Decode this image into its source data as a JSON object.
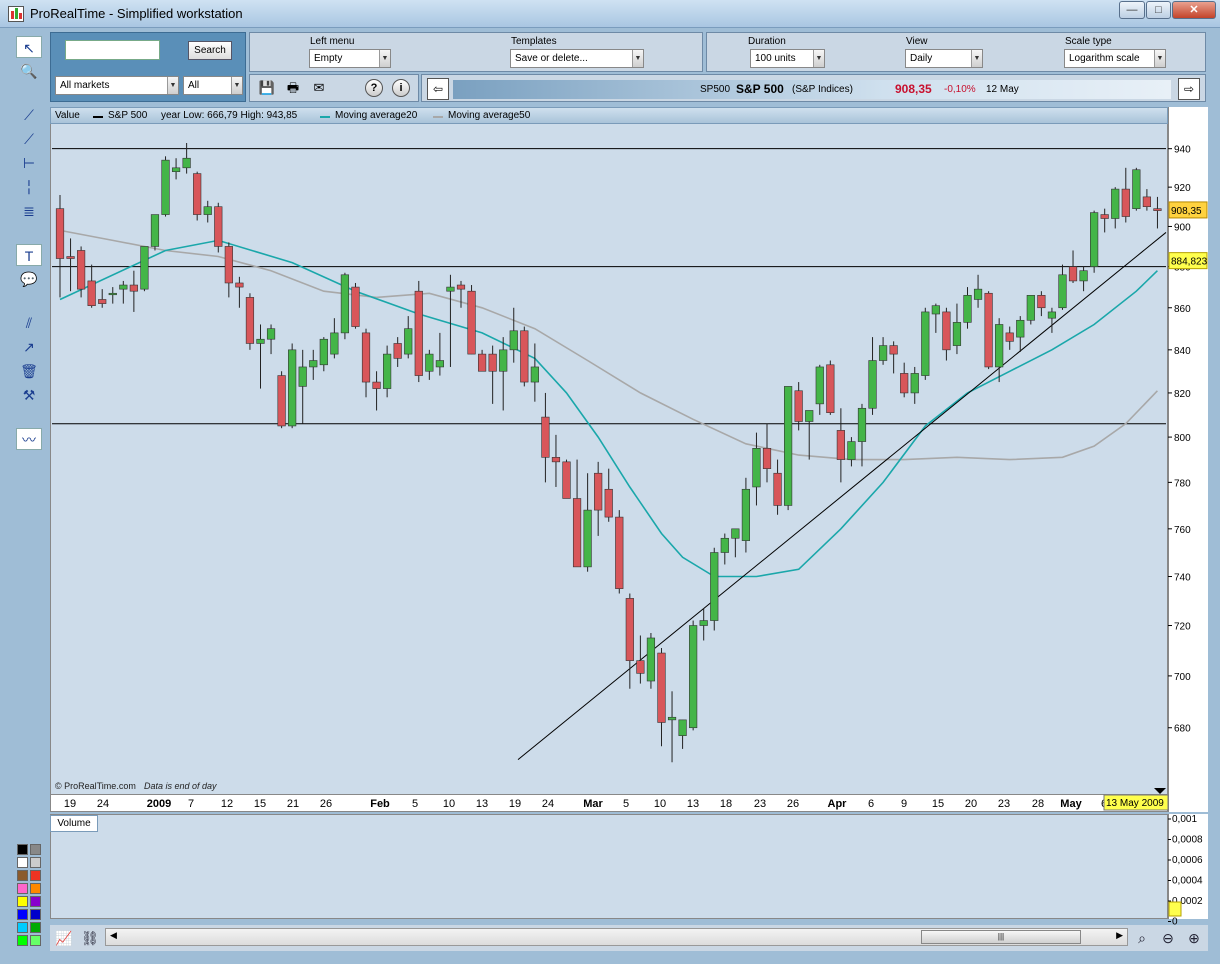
{
  "window": {
    "title": "ProRealTime - Simplified workstation"
  },
  "search": {
    "button_label": "Search",
    "input_value": "",
    "market_select": "All markets",
    "type_select": "All"
  },
  "menu_panel": {
    "left_menu_label": "Left menu",
    "left_menu_value": "Empty",
    "templates_label": "Templates",
    "templates_value": "Save or delete..."
  },
  "settings_panel": {
    "duration_label": "Duration",
    "duration_value": "100 units",
    "view_label": "View",
    "view_value": "Daily",
    "scale_label": "Scale type",
    "scale_value": "Logarithm scale"
  },
  "ticker": {
    "code": "SP500",
    "name": "S&P 500",
    "market": "(S&P Indices)",
    "price": "908,35",
    "change": "-0,10%",
    "date": "12 May"
  },
  "legend": {
    "value_label": "Value",
    "series_label": "S&P 500",
    "range_text": "year Low: 666,79 High: 943,85",
    "ma20_label": "Moving average20",
    "ma50_label": "Moving average50"
  },
  "watermark": {
    "brand": "© ProRealTime.com",
    "note": "Data is end of day"
  },
  "volume": {
    "label": "Volume",
    "ticks": [
      "0,001",
      "0,0008",
      "0,0006",
      "0,0004",
      "0,0002",
      "0"
    ]
  },
  "markers": {
    "last_price": "908,35",
    "level_price": "884,823",
    "cursor_date": "13 May 2009"
  },
  "colors": {
    "up": "#44b548",
    "down": "#d8565a",
    "ma20": "#1aa7aa",
    "ma50": "#a8a8a8",
    "chart_bg": "#cddcea"
  },
  "chart_data": {
    "type": "candlestick",
    "title": "S&P 500",
    "scale": "log",
    "ylim": [
      656,
      952
    ],
    "y_ticks": [
      680,
      700,
      720,
      740,
      760,
      780,
      800,
      820,
      840,
      860,
      880,
      900,
      920,
      940
    ],
    "x_tick_labels": [
      "19",
      "24",
      "2009",
      "7",
      "12",
      "15",
      "21",
      "26",
      "Feb",
      "5",
      "10",
      "13",
      "19",
      "24",
      "Mar",
      "5",
      "10",
      "13",
      "18",
      "23",
      "26",
      "Apr",
      "6",
      "9",
      "15",
      "20",
      "23",
      "28",
      "May",
      "6"
    ],
    "horizontal_lines": [
      940,
      880,
      806
    ],
    "candles": [
      {
        "o": 909,
        "h": 916,
        "l": 865,
        "c": 884
      },
      {
        "o": 885,
        "h": 894,
        "l": 868,
        "c": 884
      },
      {
        "o": 888,
        "h": 890,
        "l": 865,
        "c": 869
      },
      {
        "o": 873,
        "h": 881,
        "l": 860,
        "c": 861
      },
      {
        "o": 864,
        "h": 869,
        "l": 860,
        "c": 862
      },
      {
        "o": 867,
        "h": 870,
        "l": 862,
        "c": 867
      },
      {
        "o": 869,
        "h": 873,
        "l": 862,
        "c": 871
      },
      {
        "o": 871,
        "h": 878,
        "l": 858,
        "c": 868
      },
      {
        "o": 869,
        "h": 890,
        "l": 868,
        "c": 890
      },
      {
        "o": 890,
        "h": 905,
        "l": 888,
        "c": 906
      },
      {
        "o": 906,
        "h": 936,
        "l": 905,
        "c": 934
      },
      {
        "o": 928,
        "h": 935,
        "l": 924,
        "c": 930
      },
      {
        "o": 930,
        "h": 943,
        "l": 927,
        "c": 935
      },
      {
        "o": 927,
        "h": 928,
        "l": 903,
        "c": 906
      },
      {
        "o": 906,
        "h": 913,
        "l": 902,
        "c": 910
      },
      {
        "o": 910,
        "h": 912,
        "l": 887,
        "c": 890
      },
      {
        "o": 890,
        "h": 892,
        "l": 865,
        "c": 872
      },
      {
        "o": 872,
        "h": 875,
        "l": 860,
        "c": 870
      },
      {
        "o": 865,
        "h": 867,
        "l": 840,
        "c": 843
      },
      {
        "o": 843,
        "h": 852,
        "l": 822,
        "c": 845
      },
      {
        "o": 845,
        "h": 852,
        "l": 838,
        "c": 850
      },
      {
        "o": 828,
        "h": 830,
        "l": 804,
        "c": 805
      },
      {
        "o": 805,
        "h": 843,
        "l": 804,
        "c": 840
      },
      {
        "o": 823,
        "h": 840,
        "l": 806,
        "c": 832
      },
      {
        "o": 832,
        "h": 840,
        "l": 826,
        "c": 835
      },
      {
        "o": 833,
        "h": 846,
        "l": 830,
        "c": 845
      },
      {
        "o": 838,
        "h": 855,
        "l": 836,
        "c": 848
      },
      {
        "o": 848,
        "h": 877,
        "l": 845,
        "c": 876
      },
      {
        "o": 870,
        "h": 872,
        "l": 850,
        "c": 851
      },
      {
        "o": 848,
        "h": 850,
        "l": 818,
        "c": 825
      },
      {
        "o": 825,
        "h": 830,
        "l": 812,
        "c": 822
      },
      {
        "o": 822,
        "h": 842,
        "l": 818,
        "c": 838
      },
      {
        "o": 843,
        "h": 846,
        "l": 832,
        "c": 836
      },
      {
        "o": 838,
        "h": 856,
        "l": 836,
        "c": 850
      },
      {
        "o": 868,
        "h": 873,
        "l": 825,
        "c": 828
      },
      {
        "o": 830,
        "h": 840,
        "l": 826,
        "c": 838
      },
      {
        "o": 832,
        "h": 848,
        "l": 828,
        "c": 835
      },
      {
        "o": 868,
        "h": 876,
        "l": 832,
        "c": 870
      },
      {
        "o": 871,
        "h": 873,
        "l": 860,
        "c": 869
      },
      {
        "o": 868,
        "h": 871,
        "l": 838,
        "c": 838
      },
      {
        "o": 838,
        "h": 840,
        "l": 832,
        "c": 830
      },
      {
        "o": 838,
        "h": 842,
        "l": 815,
        "c": 830
      },
      {
        "o": 830,
        "h": 846,
        "l": 812,
        "c": 840
      },
      {
        "o": 840,
        "h": 860,
        "l": 834,
        "c": 849
      },
      {
        "o": 849,
        "h": 851,
        "l": 823,
        "c": 825
      },
      {
        "o": 825,
        "h": 843,
        "l": 816,
        "c": 832
      },
      {
        "o": 809,
        "h": 820,
        "l": 780,
        "c": 791
      },
      {
        "o": 791,
        "h": 801,
        "l": 778,
        "c": 789
      },
      {
        "o": 789,
        "h": 790,
        "l": 775,
        "c": 773
      },
      {
        "o": 773,
        "h": 790,
        "l": 744,
        "c": 744
      },
      {
        "o": 744,
        "h": 784,
        "l": 742,
        "c": 768
      },
      {
        "o": 784,
        "h": 789,
        "l": 757,
        "c": 768
      },
      {
        "o": 777,
        "h": 786,
        "l": 763,
        "c": 765
      },
      {
        "o": 765,
        "h": 768,
        "l": 733,
        "c": 735
      },
      {
        "o": 731,
        "h": 733,
        "l": 695,
        "c": 706
      },
      {
        "o": 706,
        "h": 716,
        "l": 697,
        "c": 701
      },
      {
        "o": 698,
        "h": 717,
        "l": 695,
        "c": 715
      },
      {
        "o": 709,
        "h": 711,
        "l": 673,
        "c": 682
      },
      {
        "o": 683,
        "h": 694,
        "l": 667,
        "c": 684
      },
      {
        "o": 677,
        "h": 683,
        "l": 672,
        "c": 683
      },
      {
        "o": 680,
        "h": 722,
        "l": 679,
        "c": 720
      },
      {
        "o": 720,
        "h": 727,
        "l": 714,
        "c": 722
      },
      {
        "o": 722,
        "h": 752,
        "l": 718,
        "c": 750
      },
      {
        "o": 750,
        "h": 758,
        "l": 745,
        "c": 756
      },
      {
        "o": 756,
        "h": 759,
        "l": 748,
        "c": 760
      },
      {
        "o": 755,
        "h": 782,
        "l": 750,
        "c": 777
      },
      {
        "o": 778,
        "h": 802,
        "l": 770,
        "c": 795
      },
      {
        "o": 795,
        "h": 806,
        "l": 780,
        "c": 786
      },
      {
        "o": 784,
        "h": 790,
        "l": 766,
        "c": 770
      },
      {
        "o": 770,
        "h": 823,
        "l": 768,
        "c": 823
      },
      {
        "o": 821,
        "h": 825,
        "l": 803,
        "c": 807
      },
      {
        "o": 807,
        "h": 812,
        "l": 790,
        "c": 812
      },
      {
        "o": 815,
        "h": 833,
        "l": 810,
        "c": 832
      },
      {
        "o": 833,
        "h": 835,
        "l": 810,
        "c": 811
      },
      {
        "o": 803,
        "h": 813,
        "l": 780,
        "c": 790
      },
      {
        "o": 790,
        "h": 800,
        "l": 787,
        "c": 798
      },
      {
        "o": 798,
        "h": 815,
        "l": 787,
        "c": 813
      },
      {
        "o": 813,
        "h": 846,
        "l": 810,
        "c": 835
      },
      {
        "o": 835,
        "h": 846,
        "l": 833,
        "c": 842
      },
      {
        "o": 842,
        "h": 844,
        "l": 829,
        "c": 838
      },
      {
        "o": 829,
        "h": 834,
        "l": 818,
        "c": 820
      },
      {
        "o": 820,
        "h": 832,
        "l": 815,
        "c": 829
      },
      {
        "o": 828,
        "h": 860,
        "l": 826,
        "c": 858
      },
      {
        "o": 857,
        "h": 862,
        "l": 848,
        "c": 861
      },
      {
        "o": 858,
        "h": 860,
        "l": 835,
        "c": 840
      },
      {
        "o": 842,
        "h": 862,
        "l": 838,
        "c": 853
      },
      {
        "o": 853,
        "h": 870,
        "l": 850,
        "c": 866
      },
      {
        "o": 864,
        "h": 876,
        "l": 860,
        "c": 869
      },
      {
        "o": 867,
        "h": 868,
        "l": 831,
        "c": 832
      },
      {
        "o": 832,
        "h": 855,
        "l": 825,
        "c": 852
      },
      {
        "o": 848,
        "h": 851,
        "l": 840,
        "c": 844
      },
      {
        "o": 846,
        "h": 856,
        "l": 839,
        "c": 854
      },
      {
        "o": 854,
        "h": 866,
        "l": 852,
        "c": 866
      },
      {
        "o": 866,
        "h": 868,
        "l": 856,
        "c": 860
      },
      {
        "o": 855,
        "h": 860,
        "l": 848,
        "c": 858
      },
      {
        "o": 860,
        "h": 881,
        "l": 859,
        "c": 876
      },
      {
        "o": 880,
        "h": 888,
        "l": 872,
        "c": 873
      },
      {
        "o": 873,
        "h": 880,
        "l": 868,
        "c": 878
      },
      {
        "o": 880,
        "h": 908,
        "l": 877,
        "c": 907
      },
      {
        "o": 906,
        "h": 909,
        "l": 897,
        "c": 904
      },
      {
        "o": 904,
        "h": 920,
        "l": 899,
        "c": 919
      },
      {
        "o": 919,
        "h": 930,
        "l": 902,
        "c": 905
      },
      {
        "o": 909,
        "h": 930,
        "l": 908,
        "c": 929
      },
      {
        "o": 915,
        "h": 919,
        "l": 908,
        "c": 910
      },
      {
        "o": 909,
        "h": 915,
        "l": 899,
        "c": 908
      }
    ],
    "ma20": [
      [
        0,
        864
      ],
      [
        10,
        888
      ],
      [
        15,
        893
      ],
      [
        22,
        882
      ],
      [
        28,
        868
      ],
      [
        34,
        857
      ],
      [
        40,
        848
      ],
      [
        45,
        836
      ],
      [
        48,
        820
      ],
      [
        51,
        800
      ],
      [
        54,
        778
      ],
      [
        57,
        758
      ],
      [
        59,
        748
      ],
      [
        62,
        740
      ],
      [
        66,
        740
      ],
      [
        70,
        743
      ],
      [
        74,
        760
      ],
      [
        78,
        780
      ],
      [
        82,
        805
      ],
      [
        86,
        820
      ],
      [
        90,
        830
      ],
      [
        94,
        840
      ],
      [
        98,
        852
      ],
      [
        102,
        868
      ],
      [
        104,
        878
      ]
    ],
    "ma50": [
      [
        0,
        898
      ],
      [
        5,
        893
      ],
      [
        10,
        888
      ],
      [
        15,
        885
      ],
      [
        20,
        878
      ],
      [
        25,
        868
      ],
      [
        30,
        865
      ],
      [
        35,
        867
      ],
      [
        40,
        860
      ],
      [
        45,
        850
      ],
      [
        50,
        835
      ],
      [
        55,
        820
      ],
      [
        60,
        808
      ],
      [
        65,
        797
      ],
      [
        70,
        792
      ],
      [
        75,
        790
      ],
      [
        80,
        790
      ],
      [
        85,
        791
      ],
      [
        90,
        790
      ],
      [
        95,
        791
      ],
      [
        98,
        796
      ],
      [
        101,
        806
      ],
      [
        104,
        821
      ]
    ],
    "trendline": [
      [
        668,
        660
      ],
      [
        1168,
        897
      ]
    ]
  }
}
